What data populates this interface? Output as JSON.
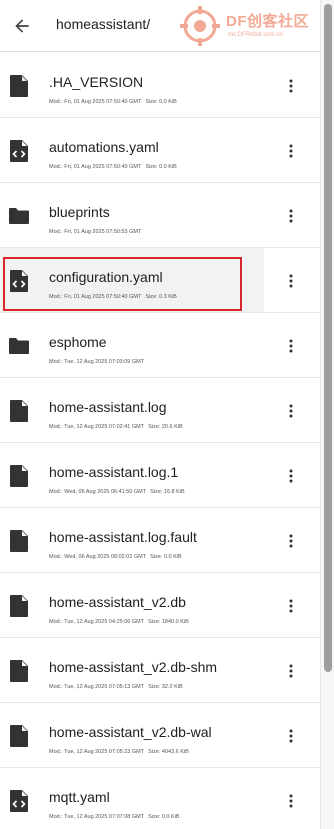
{
  "header": {
    "title": "homeassistant/",
    "watermark_text": "DF创客社区",
    "watermark_sub": "mc.DFRobot.com.cn"
  },
  "colors": {
    "icon": "#333333",
    "highlight": "#d9262c",
    "selected_bg": "#f2f2f2"
  },
  "files": [
    {
      "name": ".HA_VERSION",
      "mod": "Mod.: Fri, 01 Aug 2025 07:50:40 GMT",
      "size": "Size: 0.0 KiB",
      "icon": "file-icon"
    },
    {
      "name": "automations.yaml",
      "mod": "Mod.: Fri, 01 Aug 2025 07:50:40 GMT",
      "size": "Size: 0.0 KiB",
      "icon": "code-file-icon"
    },
    {
      "name": "blueprints",
      "mod": "Mod.: Fri, 01 Aug 2025 07:50:53 GMT",
      "size": "",
      "icon": "folder-icon"
    },
    {
      "name": "configuration.yaml",
      "mod": "Mod.: Fri, 01 Aug 2025 07:50:40 GMT",
      "size": "Size: 0.3 KiB",
      "icon": "code-file-icon"
    },
    {
      "name": "esphome",
      "mod": "Mod.: Tue, 12 Aug 2025 07:03:09 GMT",
      "size": "",
      "icon": "folder-icon"
    },
    {
      "name": "home-assistant.log",
      "mod": "Mod.: Tue, 12 Aug 2025 07:02:41 GMT",
      "size": "Size: 20.6 KiB",
      "icon": "file-icon"
    },
    {
      "name": "home-assistant.log.1",
      "mod": "Mod.: Wed, 06 Aug 2025 06:41:50 GMT",
      "size": "Size: 16.8 KiB",
      "icon": "file-icon"
    },
    {
      "name": "home-assistant.log.fault",
      "mod": "Mod.: Wed, 06 Aug 2025 08:02:02 GMT",
      "size": "Size: 0.0 KiB",
      "icon": "file-icon"
    },
    {
      "name": "home-assistant_v2.db",
      "mod": "Mod.: Tue, 12 Aug 2025 04:25:06 GMT",
      "size": "Size: 1840.0 KiB",
      "icon": "file-icon"
    },
    {
      "name": "home-assistant_v2.db-shm",
      "mod": "Mod.: Tue, 12 Aug 2025 07:05:13 GMT",
      "size": "Size: 32.0 KiB",
      "icon": "file-icon"
    },
    {
      "name": "home-assistant_v2.db-wal",
      "mod": "Mod.: Tue, 12 Aug 2025 07:05:23 GMT",
      "size": "Size: 4043.6 KiB",
      "icon": "file-icon"
    },
    {
      "name": "mqtt.yaml",
      "mod": "Mod.: Tue, 12 Aug 2025 07:07:08 GMT",
      "size": "Size: 0.0 KiB",
      "icon": "code-file-icon"
    }
  ]
}
